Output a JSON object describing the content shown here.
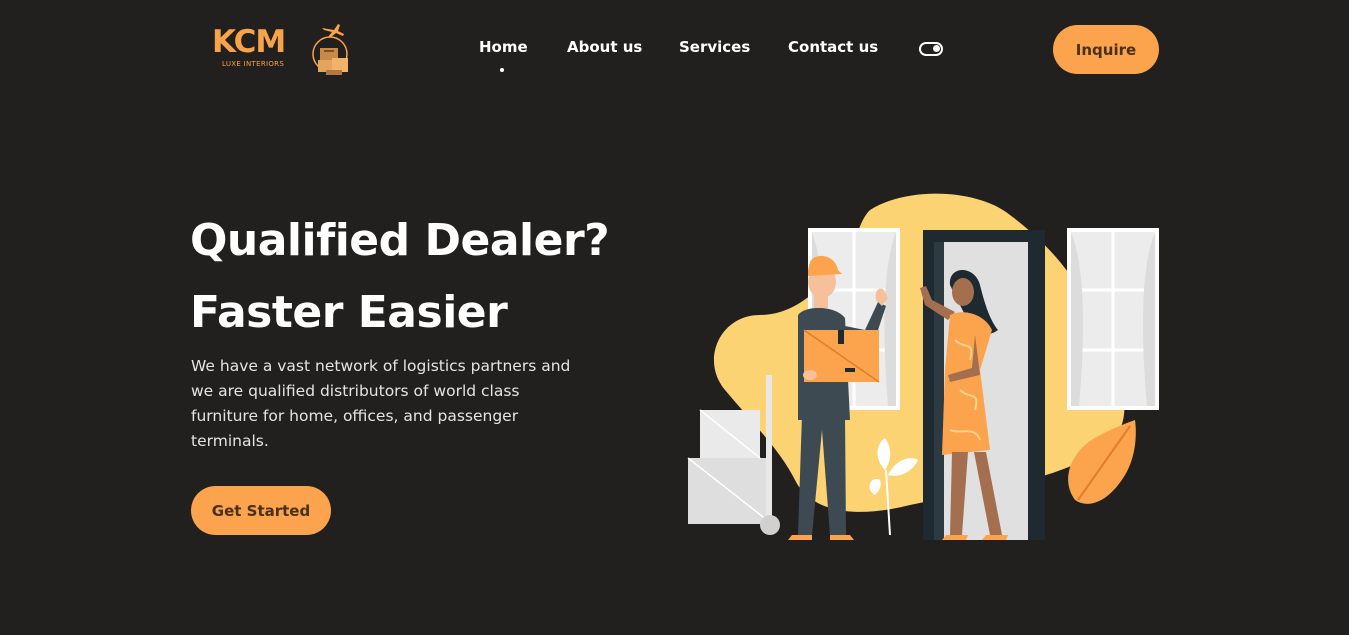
{
  "brand": {
    "name": "KCM",
    "tagline": "LUXE INTERIORS",
    "accent": "#fca34d",
    "background": "#22201e"
  },
  "nav": {
    "items": [
      {
        "label": "Home",
        "active": true
      },
      {
        "label": "About us",
        "active": false
      },
      {
        "label": "Services",
        "active": false
      },
      {
        "label": "Contact us",
        "active": false
      }
    ],
    "theme_toggle_icon": "toggle-icon",
    "inquire_label": "Inquire"
  },
  "hero": {
    "title_line1": "Qualified Dealer?",
    "title_line2": "Faster Easier",
    "description": "We have a vast network of logistics partners and we are qualified distributors of world class furniture for home, offices, and passenger terminals.",
    "cta_label": "Get Started"
  },
  "illustration": {
    "name": "delivery-illustration",
    "colors": {
      "blob": "#fcd373",
      "orange": "#fca34d",
      "uniform": "#3e4a52",
      "skin_man": "#f6c09a",
      "skin_woman": "#a46f4e",
      "door": "#1f2a30",
      "window": "#ffffff"
    }
  }
}
